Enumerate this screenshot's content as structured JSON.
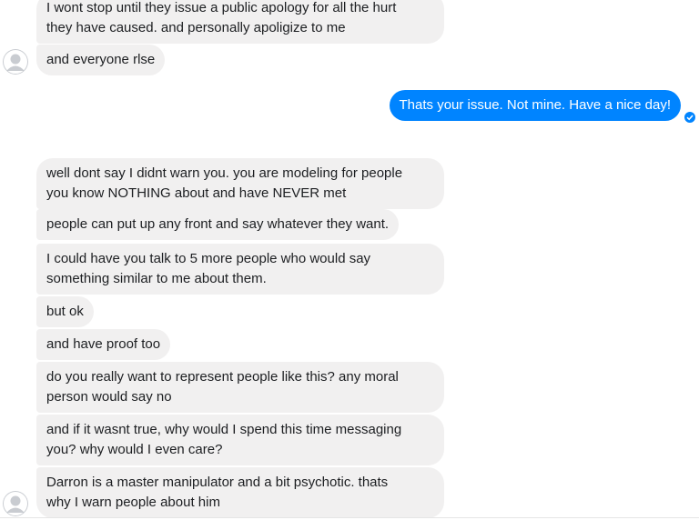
{
  "conversation": {
    "messages": [
      {
        "lines": [
          "I wont stop until they issue a public apology for all the hurt",
          "they have caused. and personally apoligize to me"
        ]
      },
      {
        "lines": [
          "and everyone rlse"
        ]
      },
      {
        "lines": [
          "Thats your issue. Not mine. Have a nice day!"
        ]
      },
      {
        "lines": [
          "well dont say I didnt warn you. you are modeling for people",
          "you know NOTHING about and have NEVER met"
        ]
      },
      {
        "lines": [
          "people can put up any front and say whatever they want."
        ]
      },
      {
        "lines": [
          "I could have you talk to 5 more people who would say",
          "something similar to me about them."
        ]
      },
      {
        "lines": [
          "but ok"
        ]
      },
      {
        "lines": [
          "and have proof too"
        ]
      },
      {
        "lines": [
          "do you really want to represent people like this? any moral",
          "person would say no"
        ]
      },
      {
        "lines": [
          "and if it wasnt true, why would I spend this time messaging",
          "you? why would I even care?"
        ]
      },
      {
        "lines": [
          "Darron is a master manipulator and a bit psychotic. thats",
          "why I warn people about him"
        ]
      }
    ]
  },
  "colors": {
    "received_bubble": "#f1f0f0",
    "sent_bubble": "#0084ff",
    "sent_text": "#ffffff"
  },
  "icons": {
    "avatar": "default-avatar-icon",
    "seen": "seen-check-icon"
  }
}
